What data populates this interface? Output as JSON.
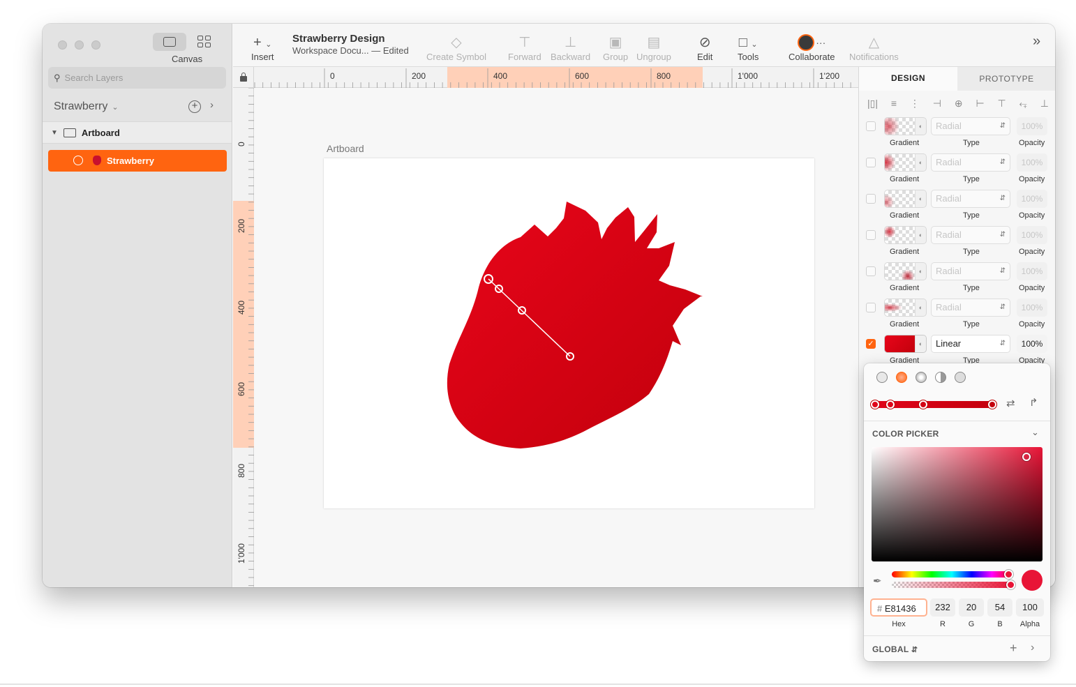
{
  "window": {
    "view_label": "Canvas",
    "search_placeholder": "Search Layers",
    "page_name": "Strawberry",
    "artboard_layer": "Artboard",
    "selected_layer": "Strawberry"
  },
  "toolbar": {
    "insert": "Insert",
    "doc_title": "Strawberry Design",
    "doc_subtitle": "Workspace Docu...",
    "doc_status": "— Edited",
    "create_symbol": "Create Symbol",
    "forward": "Forward",
    "backward": "Backward",
    "group": "Group",
    "ungroup": "Ungroup",
    "edit": "Edit",
    "tools": "Tools",
    "collaborate": "Collaborate",
    "notifications": "Notifications"
  },
  "rulers": {
    "horizontal": [
      "0",
      "200",
      "400",
      "600",
      "800",
      "1'000",
      "1'200"
    ],
    "vertical": [
      "0",
      "200",
      "400",
      "600",
      "800",
      "1'000"
    ]
  },
  "canvas": {
    "artboard_label": "Artboard"
  },
  "inspector": {
    "tabs": [
      "DESIGN",
      "PROTOTYPE"
    ],
    "fills": [
      {
        "label": "Gradient",
        "type_label": "Type",
        "opacity_label": "Opacity",
        "type": "Radial",
        "opacity": "100%",
        "enabled": false
      },
      {
        "label": "Gradient",
        "type_label": "Type",
        "opacity_label": "Opacity",
        "type": "Radial",
        "opacity": "100%",
        "enabled": false
      },
      {
        "label": "Gradient",
        "type_label": "Type",
        "opacity_label": "Opacity",
        "type": "Radial",
        "opacity": "100%",
        "enabled": false
      },
      {
        "label": "Gradient",
        "type_label": "Type",
        "opacity_label": "Opacity",
        "type": "Radial",
        "opacity": "100%",
        "enabled": false
      },
      {
        "label": "Gradient",
        "type_label": "Type",
        "opacity_label": "Opacity",
        "type": "Radial",
        "opacity": "100%",
        "enabled": false
      },
      {
        "label": "Gradient",
        "type_label": "Type",
        "opacity_label": "Opacity",
        "type": "Radial",
        "opacity": "100%",
        "enabled": false
      },
      {
        "label": "Gradient",
        "type_label": "Type",
        "opacity_label": "Opacity",
        "type": "Linear",
        "opacity": "100%",
        "enabled": true
      }
    ]
  },
  "color_picker": {
    "section_title": "COLOR PICKER",
    "hex": "E81436",
    "r": "232",
    "g": "20",
    "b": "54",
    "alpha": "100",
    "labels": {
      "hex": "Hex",
      "r": "R",
      "g": "G",
      "b": "B",
      "alpha": "Alpha"
    },
    "global_label": "GLOBAL",
    "current_color": "#E81436"
  },
  "colors": {
    "accent": "#FF6410",
    "fill_start": "#E8051A",
    "fill_end": "#C4000D"
  }
}
